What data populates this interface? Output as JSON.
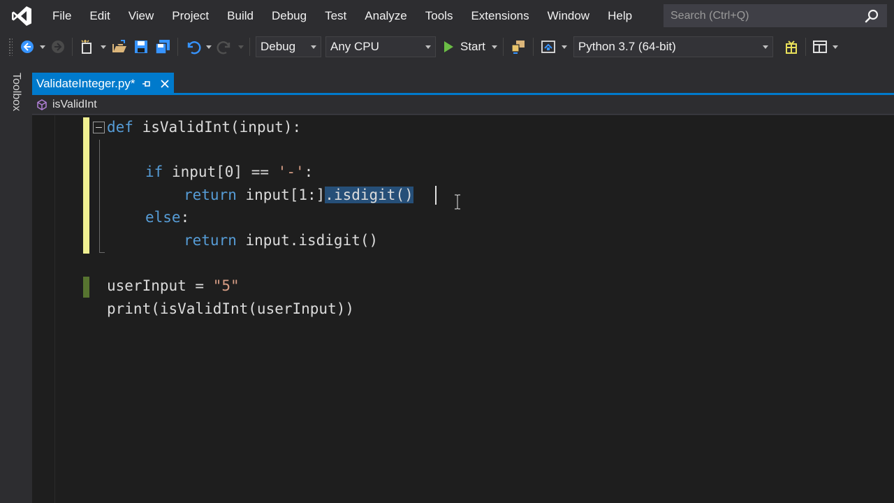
{
  "menu": {
    "items": [
      "File",
      "Edit",
      "View",
      "Project",
      "Build",
      "Debug",
      "Test",
      "Analyze",
      "Tools",
      "Extensions",
      "Window",
      "Help"
    ]
  },
  "search": {
    "placeholder": "Search (Ctrl+Q)"
  },
  "toolbar": {
    "configuration": "Debug",
    "platform": "Any CPU",
    "start_label": "Start",
    "environment": "Python 3.7 (64-bit)"
  },
  "toolbox": {
    "label": "Toolbox"
  },
  "tab": {
    "label": "ValidateInteger.py*"
  },
  "navbar": {
    "scope": "isValidInt"
  },
  "code": {
    "line1_kw": "def",
    "line1_rest": " isValidInt(input):",
    "line3_kw": "if",
    "line3_mid": " input[0] == ",
    "line3_str": "'-'",
    "line3_end": ":",
    "line4_kw": "return",
    "line4_mid": " input[1:]",
    "line4_sel": ".isdigit()",
    "line5_kw": "else",
    "line5_end": ":",
    "line6_kw": "return",
    "line6_rest": " input.isdigit()",
    "line8_a": "userInput = ",
    "line8_str": "\"5\"",
    "line9": "print(isValidInt(userInput))"
  },
  "colors": {
    "accent": "#007acc",
    "keyword": "#569cd6",
    "string": "#d69d85",
    "unsaved_change": "#efef91",
    "saved_change": "#577430",
    "play": "#6bbd45"
  }
}
